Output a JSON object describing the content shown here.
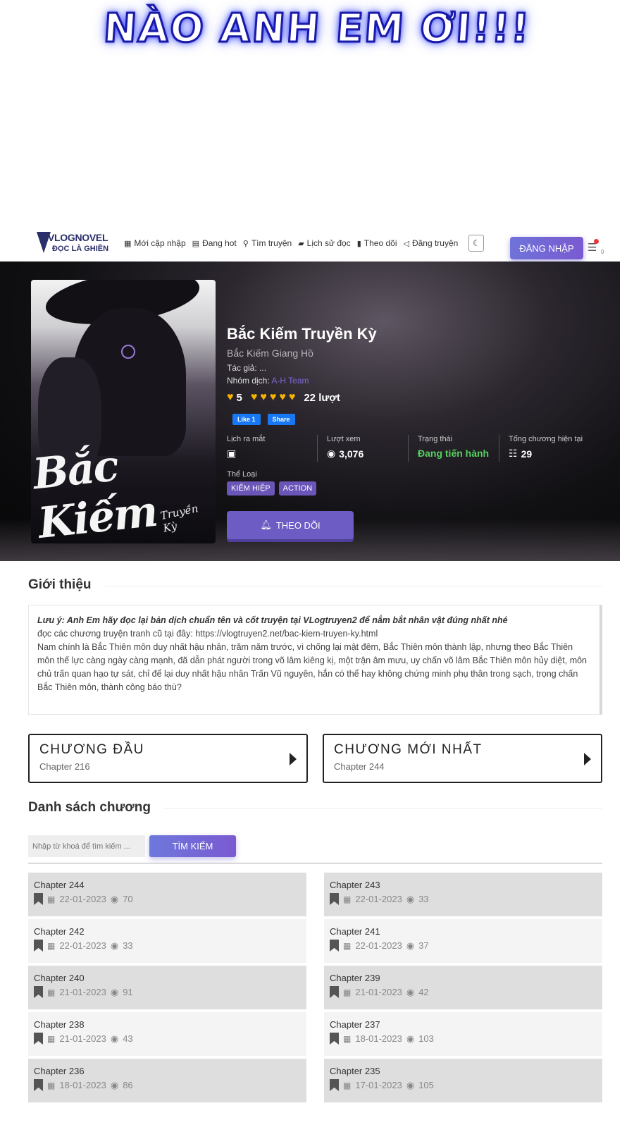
{
  "banner": {
    "text": "NÀO ANH EM ƠI!!!"
  },
  "logo": {
    "title": "VLOGNOVEL",
    "subtitle": "ĐỌC LÀ GHIỀN"
  },
  "nav": {
    "items": [
      {
        "label": "Mới cập nhập",
        "icon": "grid-icon"
      },
      {
        "label": "Đang hot",
        "icon": "newspaper-icon"
      },
      {
        "label": "Tìm truyện",
        "icon": "search-icon"
      },
      {
        "label": "Lịch sử đọc",
        "icon": "book-icon"
      },
      {
        "label": "Theo dõi",
        "icon": "bookmark-icon"
      },
      {
        "label": "Đăng truyện",
        "icon": "megaphone-icon"
      }
    ],
    "login": "ĐĂNG NHẬP",
    "notif_count": "0"
  },
  "manga": {
    "title": "Bắc Kiếm Truyền Kỳ",
    "alt_title": "Bắc Kiếm Giang Hồ",
    "author_label": "Tác giả:",
    "author": "...",
    "group_label": "Nhóm dịch:",
    "group": "A-H Team",
    "rating": "5",
    "rating_count": "22 lượt",
    "fb_like": "Like 1",
    "fb_share": "Share",
    "cover_title": "Bắc Kiếm",
    "cover_sub": "Truyền Kỳ",
    "stats": [
      {
        "label": "Lịch ra mắt",
        "value": ""
      },
      {
        "label": "Lượt xem",
        "value": "3,076"
      },
      {
        "label": "Trạng thái",
        "value": "Đang tiến hành"
      },
      {
        "label": "Tổng chương hiện tại",
        "value": "29"
      }
    ],
    "genre_label": "Thể Loại",
    "genres": [
      "KIẾM HIỆP",
      "ACTION"
    ],
    "follow": "THEO DÕI"
  },
  "intro": {
    "heading": "Giới thiệu",
    "note": "Lưu ý: Anh Em hãy đọc lại bản dịch chuẩn tên và cốt truyện tại VLogtruyen2 để nắm bắt nhân vật đúng nhất nhé",
    "link_line": "đọc các chương truyện tranh cũ tại đây: https://vlogtruyen2.net/bac-kiem-truyen-ky.html",
    "body": "Nam chính là Bắc Thiên môn duy nhất hậu nhân, trăm năm trước, vì chống lại mật đêm, Bắc Thiên môn thành lập, nhưng theo Bắc Thiên môn thế lực càng ngày càng mạnh, đã dẫn phát người trong võ lâm kiêng kị, một trận âm mưu, uy chấn võ lâm Bắc Thiên môn hủy diệt, môn chủ trấn quan hạo tự sát, chỉ để lại duy nhất hậu nhân Trấn Vũ nguyên, hắn có thể hay không chứng minh phụ thân trong sạch, trọng chấn Bắc Thiên môn, thành công báo thù?"
  },
  "first_chapter": {
    "heading": "CHƯƠNG ĐẦU",
    "chapter": "Chapter 216"
  },
  "latest_chapter": {
    "heading": "CHƯƠNG MỚI NHẤT",
    "chapter": "Chapter 244"
  },
  "chapter_list": {
    "heading": "Danh sách chương",
    "search_placeholder": "Nhập từ khoá để tìm kiếm ...",
    "search_button": "TÌM KIẾM",
    "items": [
      {
        "name": "Chapter 244",
        "date": "22-01-2023",
        "views": "70"
      },
      {
        "name": "Chapter 243",
        "date": "22-01-2023",
        "views": "33"
      },
      {
        "name": "Chapter 242",
        "date": "22-01-2023",
        "views": "33"
      },
      {
        "name": "Chapter 241",
        "date": "22-01-2023",
        "views": "37"
      },
      {
        "name": "Chapter 240",
        "date": "21-01-2023",
        "views": "91"
      },
      {
        "name": "Chapter 239",
        "date": "21-01-2023",
        "views": "42"
      },
      {
        "name": "Chapter 238",
        "date": "21-01-2023",
        "views": "43"
      },
      {
        "name": "Chapter 237",
        "date": "18-01-2023",
        "views": "103"
      },
      {
        "name": "Chapter 236",
        "date": "18-01-2023",
        "views": "86"
      },
      {
        "name": "Chapter 235",
        "date": "17-01-2023",
        "views": "105"
      }
    ]
  },
  "colors": {
    "accent": "#6c5cc4",
    "status_green": "#55d15f",
    "heart": "#f4b400"
  }
}
